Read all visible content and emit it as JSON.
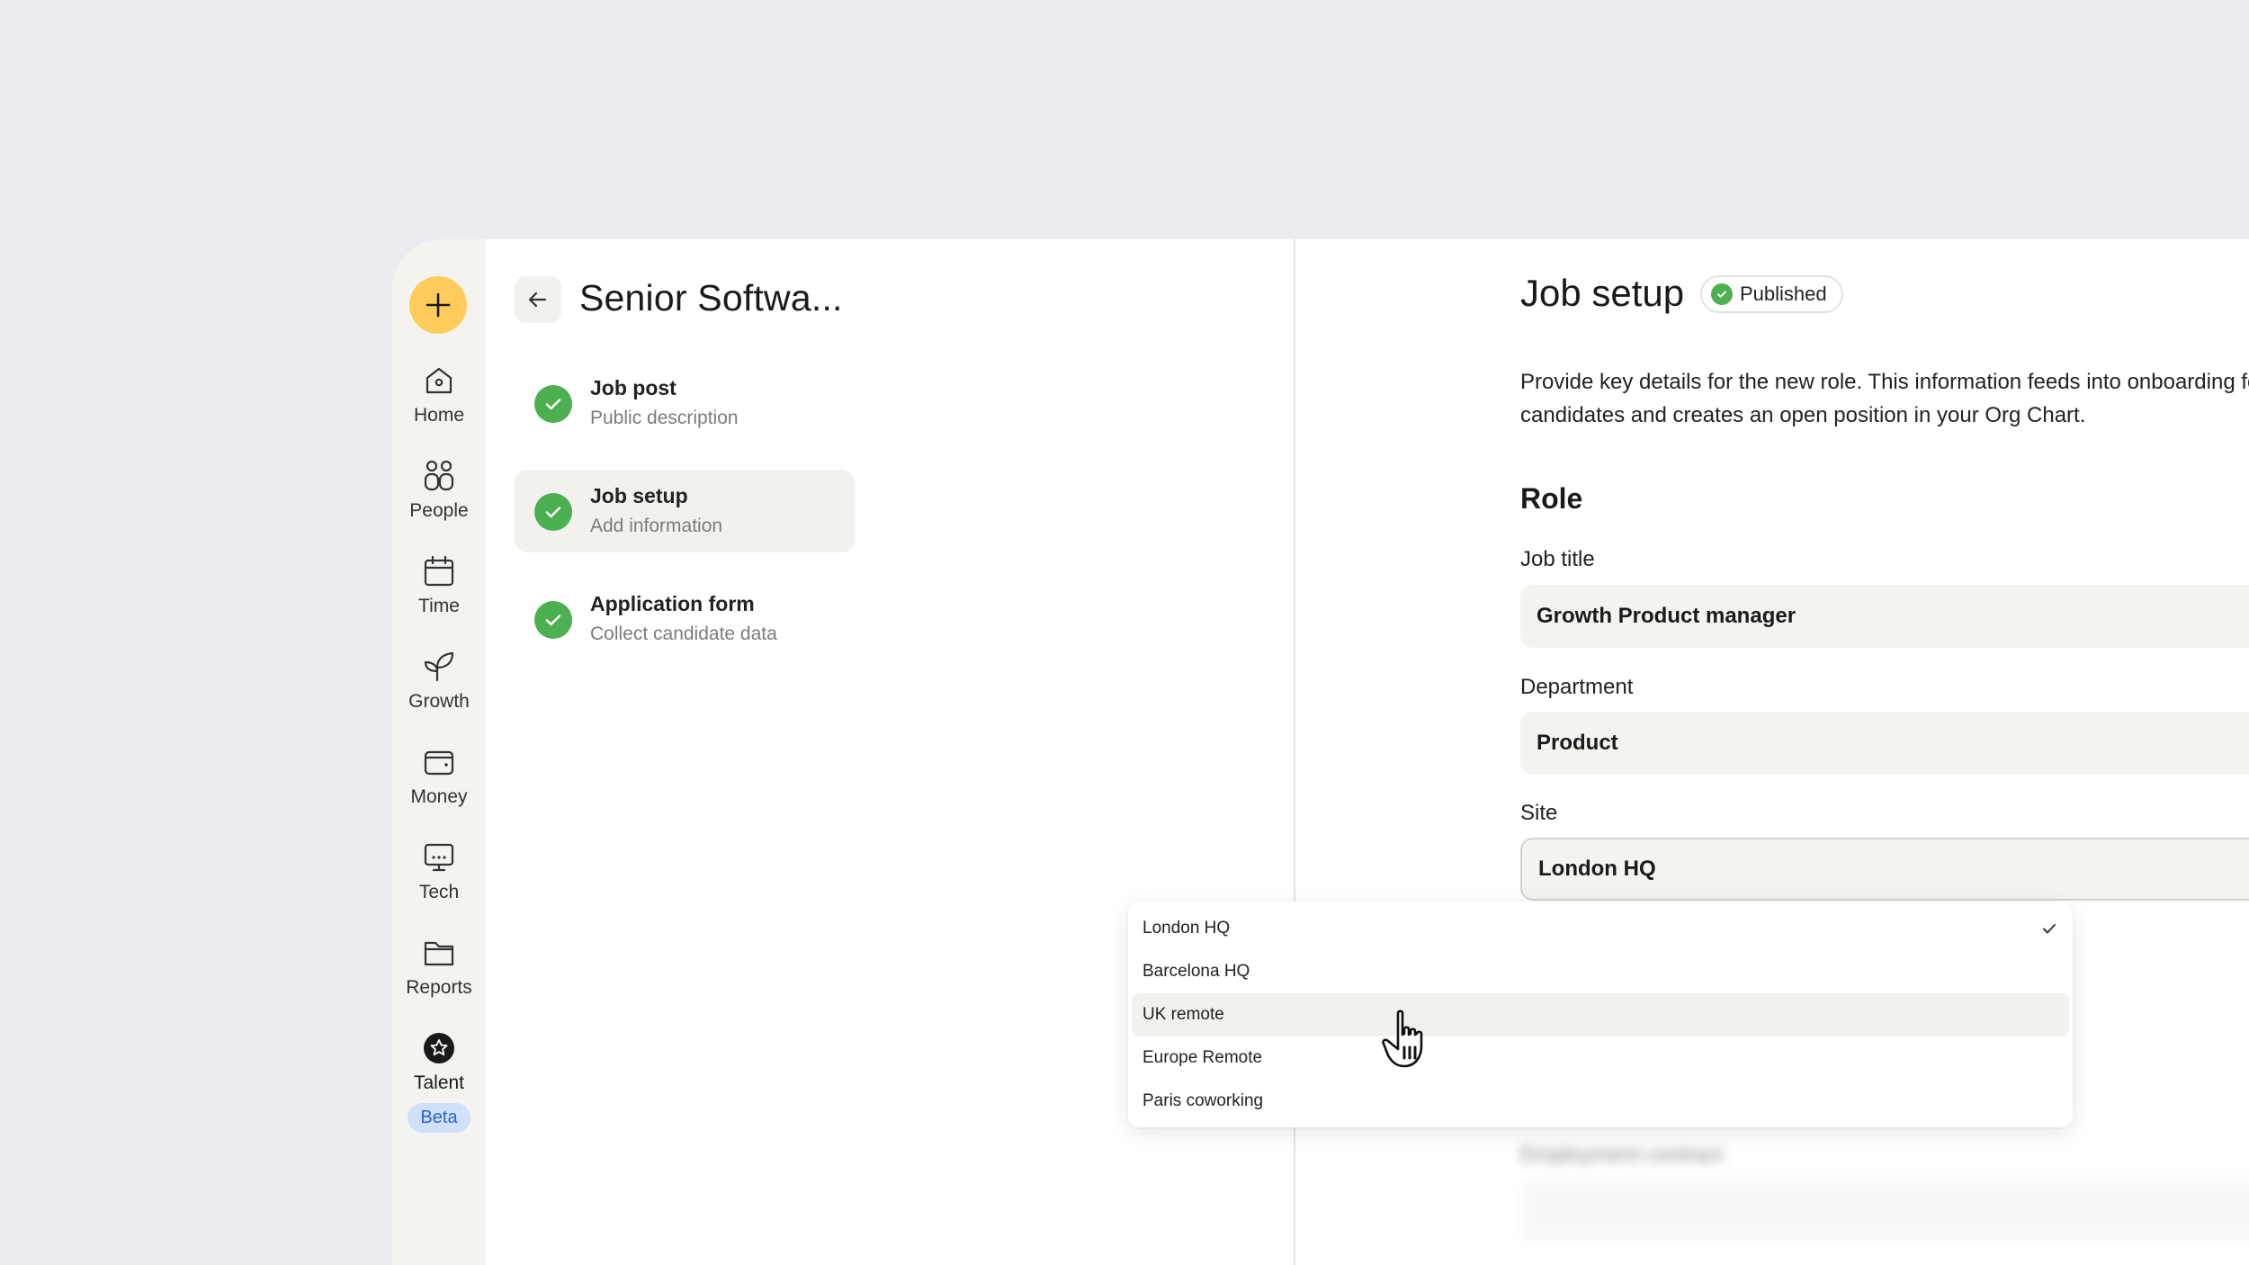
{
  "rail": {
    "items": [
      {
        "label": "Home",
        "icon": "home-icon"
      },
      {
        "label": "People",
        "icon": "people-icon"
      },
      {
        "label": "Time",
        "icon": "calendar-icon"
      },
      {
        "label": "Growth",
        "icon": "plant-icon"
      },
      {
        "label": "Money",
        "icon": "wallet-icon"
      },
      {
        "label": "Tech",
        "icon": "monitor-icon"
      },
      {
        "label": "Reports",
        "icon": "folder-icon"
      },
      {
        "label": "Talent",
        "icon": "talent-star-icon"
      }
    ],
    "beta_badge": "Beta"
  },
  "steps_panel": {
    "title": "Senior Softwa...",
    "steps": [
      {
        "title": "Job post",
        "subtitle": "Public description",
        "complete": true
      },
      {
        "title": "Job setup",
        "subtitle": "Add information",
        "complete": true,
        "active": true
      },
      {
        "title": "Application form",
        "subtitle": "Collect candidate data",
        "complete": true
      }
    ]
  },
  "main": {
    "title": "Job setup",
    "status": "Published",
    "intro": "Provide key details for the new role. This information feeds into onboarding for successful candidates and creates an open position in your Org Chart.",
    "section_title": "Role",
    "fields": {
      "job_title": {
        "label": "Job title",
        "value": "Growth Product manager"
      },
      "department": {
        "label": "Department",
        "value": "Product"
      },
      "site": {
        "label": "Site",
        "value": "London HQ"
      }
    },
    "site_options": [
      {
        "label": "London HQ",
        "selected": true
      },
      {
        "label": "Barcelona HQ"
      },
      {
        "label": "UK remote",
        "hovered": true
      },
      {
        "label": "Europe Remote"
      },
      {
        "label": "Paris coworking"
      }
    ],
    "blurred_field_label": "Employment contract"
  },
  "colors": {
    "accent_yellow": "#ffcc5c",
    "success_green": "#4caf50",
    "field_bg": "#f5f3f0",
    "beta_bg": "#cfe0fb"
  }
}
